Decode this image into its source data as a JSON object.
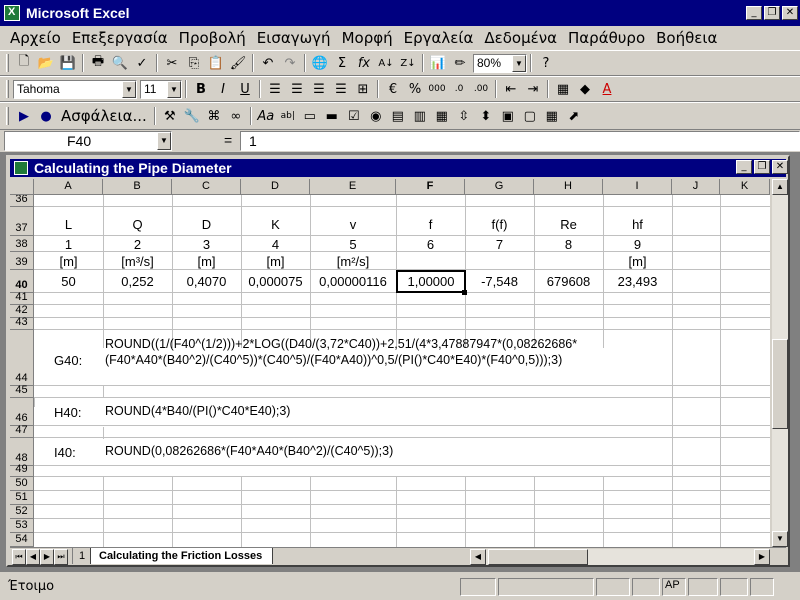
{
  "app": {
    "title": "Microsoft Excel"
  },
  "menu": [
    "Αρχείο",
    "Επεξεργασία",
    "Προβολή",
    "Εισαγωγή",
    "Μορφή",
    "Εργαλεία",
    "Δεδομένα",
    "Παράθυρο",
    "Βοήθεια"
  ],
  "toolbar": {
    "zoom": "80%"
  },
  "format_toolbar": {
    "font": "Tahoma",
    "size": "11"
  },
  "forms_toolbar": {
    "label": "Ασφάλεια..."
  },
  "formula_bar": {
    "cell_ref": "F40",
    "equals": "=",
    "value": "1"
  },
  "workbook": {
    "title": "Calculating the Pipe Diameter",
    "sheet_tab": "1",
    "sheet_tab2": "Calculating the Friction Losses"
  },
  "columns": [
    "A",
    "B",
    "C",
    "D",
    "E",
    "F",
    "G",
    "H",
    "I",
    "J",
    "K"
  ],
  "rows": {
    "r36": "36",
    "r37": "37",
    "r38": "38",
    "r39": "39",
    "r40": "40",
    "r41": "41",
    "r42": "42",
    "r43": "43",
    "r44": "44",
    "r45": "45",
    "r46": "46",
    "r47": "47",
    "r48": "48",
    "r49": "49",
    "r50": "50",
    "r51": "51",
    "r52": "52",
    "r53": "53",
    "r54": "54"
  },
  "table": {
    "headers": [
      "L",
      "Q",
      "D",
      "K",
      "v",
      "f",
      "f(f)",
      "Re",
      "hf"
    ],
    "indices": [
      "1",
      "2",
      "3",
      "4",
      "5",
      "6",
      "7",
      "8",
      "9"
    ],
    "units": [
      "[m]",
      "[m³/s]",
      "[m]",
      "[m]",
      "[m²/s]",
      "",
      "",
      "",
      "[m]"
    ],
    "values": [
      "50",
      "0,252",
      "0,4070",
      "0,000075",
      "0,00000116",
      "1,00000",
      "-7,548",
      "679608",
      "23,493"
    ]
  },
  "formulas": {
    "g40_label": "G40:",
    "g40_line1": "ROUND((1/(F40^(1/2)))+2*LOG((D40/(3,72*C40))+2,51/(4*3,47887947*(0,08262686*",
    "g40_line2": "(F40*A40*(B40^2)/(C40^5))*(C40^5)/(F40*A40))^0,5/(PI()*C40*E40)*(F40^0,5)));3)",
    "h40_label": "H40:",
    "h40": "ROUND(4*B40/(PI()*C40*E40);3)",
    "i40_label": "I40:",
    "i40": "ROUND(0,08262686*(F40*A40*(B40^2)/(C40^5));3)"
  },
  "status": {
    "ready": "Έτοιμο",
    "indicator": "AP"
  }
}
